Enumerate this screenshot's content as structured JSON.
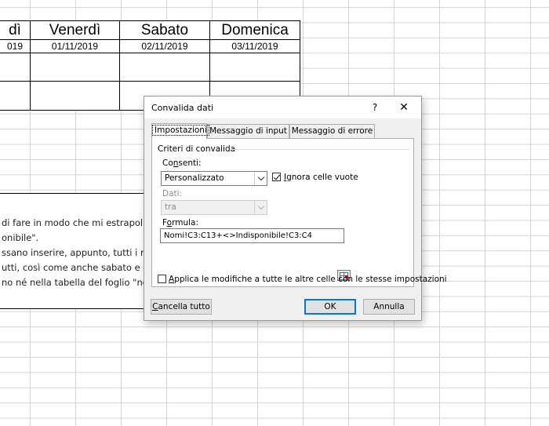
{
  "sheet": {
    "days": [
      "dì",
      "Venerdì",
      "Sabato",
      "Domenica"
    ],
    "dates": [
      "019",
      "01/11/2019",
      "02/11/2019",
      "03/11/2019"
    ],
    "textbox_lines": [
      "di fare in modo che mi estrapoli i",
      "onibile\".",
      "ssano inserire, appunto, tutti i no",
      "utti, così come anche sabato e dor",
      "no né nella tabella del foglio \"nor"
    ]
  },
  "dialog": {
    "title": "Convalida dati",
    "help_label": "?",
    "close_label": "✕",
    "tabs": [
      {
        "label": "Impostazioni",
        "active": true
      },
      {
        "label": "Messaggio di input",
        "active": false
      },
      {
        "label": "Messaggio di errore",
        "active": false
      }
    ],
    "group_label": "Criteri di convalida",
    "allow": {
      "label_pre": "Co",
      "label_u": "n",
      "label_post": "senti:",
      "value": "Personalizzato"
    },
    "ignore_blank": {
      "label_u": "I",
      "label_post": "gnora celle vuote",
      "checked": true
    },
    "data": {
      "label": "Dati:",
      "value": "tra"
    },
    "formula": {
      "label_pre": "F",
      "label_u": "o",
      "label_post": "rmula:",
      "value": "Nomi!C3:C13+<>Indisponibile!C3:C4"
    },
    "apply_all": {
      "label_u": "A",
      "label_post": "pplica le modifiche a tutte le altre celle con le stesse impostazioni",
      "checked": false
    },
    "clear_all": {
      "label_u": "C",
      "label_post": "ancella tutto"
    },
    "ok_label": "OK",
    "cancel_label": "Annulla"
  }
}
